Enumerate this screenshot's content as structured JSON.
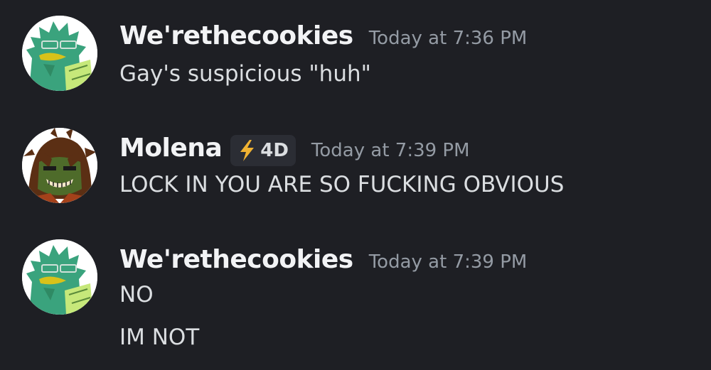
{
  "messages": [
    {
      "username": "We'rethecookies",
      "timestamp": "Today at 7:36 PM",
      "lines": [
        "Gay's suspicious \"huh\""
      ],
      "avatar_icon": "green-creature-avatar"
    },
    {
      "username": "Molena",
      "badge": {
        "icon": "lightning-bolt-icon",
        "label": "4D"
      },
      "timestamp": "Today at 7:39 PM",
      "lines": [
        "LOCK IN YOU ARE SO FUCKING OBVIOUS"
      ],
      "avatar_icon": "brown-haired-character-avatar"
    },
    {
      "username": "We'rethecookies",
      "timestamp": "Today at 7:39 PM",
      "lines": [
        "NO",
        "IM NOT"
      ],
      "avatar_icon": "green-creature-avatar"
    }
  ],
  "colors": {
    "background": "#1e1f24",
    "username": "#f2f3f5",
    "timestamp": "#949ba4",
    "text": "#dbdee1",
    "badge_bg": "#2b2d34",
    "bolt": "#f0b232"
  }
}
